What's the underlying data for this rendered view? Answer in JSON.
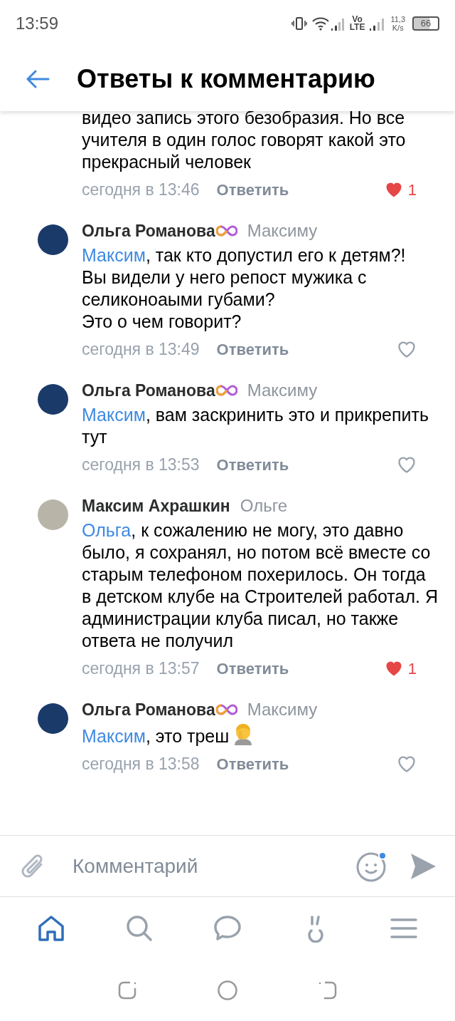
{
  "status_bar": {
    "time": "13:59",
    "volte_top": "Vo",
    "volte_bottom": "LTE",
    "speed_value": "11,3",
    "speed_unit": "K/s",
    "battery": "66"
  },
  "header": {
    "title": "Ответы к комментарию"
  },
  "partial_comment": {
    "text": "видео запись этого безобразия. Но все учителя в один голос говорят какой это прекрасный человек",
    "time": "сегодня в 13:46",
    "reply_label": "Ответить",
    "liked": true,
    "like_count": "1"
  },
  "comments": [
    {
      "author": "Ольга Романова",
      "badge": true,
      "reply_to": "Максиму",
      "mention": "Максим",
      "text": ", так кто допустил его к детям?!\nВы видели у него репост мужика с селиконоаыми губами?\nЭто о чем говорит?",
      "emoji": false,
      "time": "сегодня в 13:49",
      "reply_label": "Ответить",
      "liked": false
    },
    {
      "author": "Ольга Романова",
      "badge": true,
      "reply_to": "Максиму",
      "mention": "Максим",
      "text": ", вам заскринить это и прикрепить тут",
      "emoji": false,
      "time": "сегодня в 13:53",
      "reply_label": "Ответить",
      "liked": false
    },
    {
      "author": "Максим Ахрашкин",
      "badge": false,
      "reply_to": "Ольге",
      "mention": "Ольга",
      "text": ", к сожалению не могу, это давно было, я сохранял, но потом всё вместе со старым телефоном похерилось. Он тогда в детском клубе на Строителей работал. Я администрации клуба писал, но также ответа не получил",
      "emoji": false,
      "time": "сегодня в 13:57",
      "reply_label": "Ответить",
      "liked": true,
      "like_count": "1"
    },
    {
      "author": "Ольга Романова",
      "badge": true,
      "reply_to": "Максиму",
      "mention": "Максим",
      "text": ", это треш",
      "emoji": true,
      "time": "сегодня в 13:58",
      "reply_label": "Ответить",
      "liked": false
    }
  ],
  "composer": {
    "placeholder": "Комментарий",
    "emoji_notification": true
  },
  "nav": [
    {
      "kind": "home",
      "selected": true
    },
    {
      "kind": "search",
      "selected": false
    },
    {
      "kind": "messages",
      "selected": false
    },
    {
      "kind": "clips",
      "selected": false
    },
    {
      "kind": "menu",
      "selected": false
    }
  ]
}
